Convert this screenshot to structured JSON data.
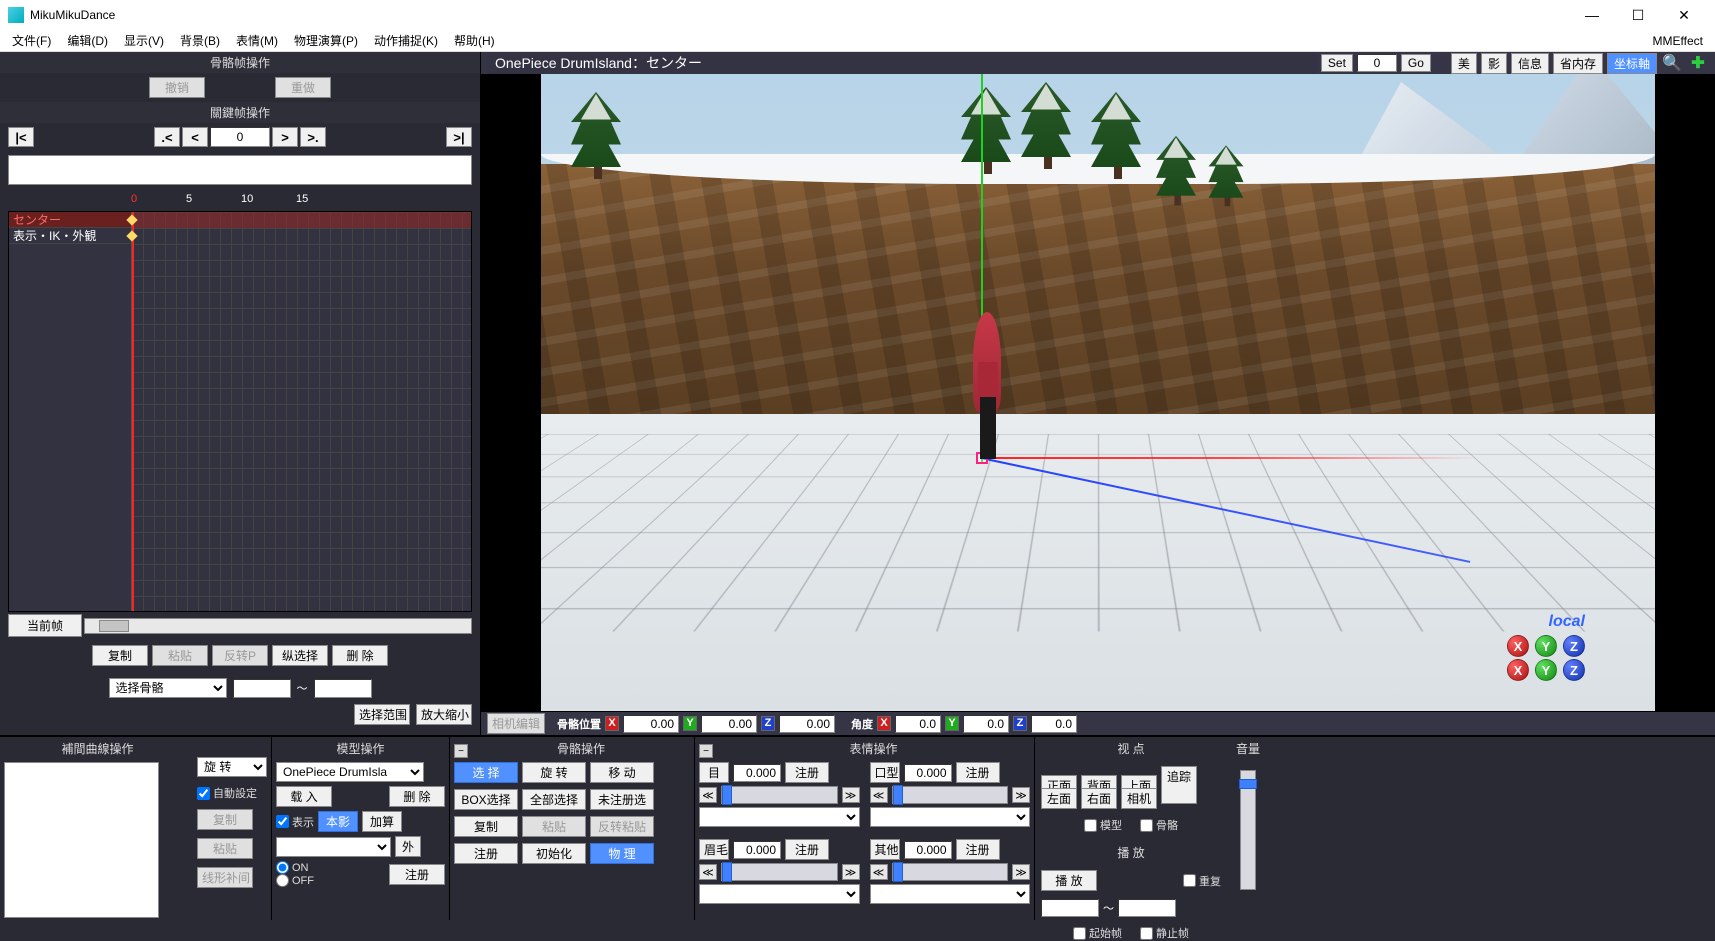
{
  "title": "MikuMikuDance",
  "menubar": [
    "文件(F)",
    "编辑(D)",
    "显示(V)",
    "背景(B)",
    "表情(M)",
    "物理演算(P)",
    "动作捕捉(K)",
    "帮助(H)"
  ],
  "mmeffect": "MMEffect",
  "bone_ops_title": "骨骼帧操作",
  "undo": "撤销",
  "redo": "重做",
  "key_ops_title": "關鍵帧操作",
  "frame_current": "0",
  "ruler": [
    "0",
    "5",
    "10",
    "15"
  ],
  "tracks": [
    "センター",
    "表示・IK・外観"
  ],
  "current_frame_label": "当前帧",
  "frame_ops": {
    "copy": "复制",
    "paste": "粘贴",
    "reverse": "反转P",
    "colsel": "纵选择",
    "delete": "删 除"
  },
  "select_bone": "选择骨骼",
  "range_sep": "～",
  "select_range": "选择范围",
  "zoom": "放大缩小",
  "view": {
    "title": "OnePiece DrumIsland：センター",
    "set": "Set",
    "set_val": "0",
    "go": "Go",
    "beauty": "美",
    "shadow": "影",
    "info": "信息",
    "savemem": "省内存",
    "axes": "坐标軸",
    "local": "local"
  },
  "status": {
    "cam_edit": "相机编辑",
    "bone_pos": "骨骼位置",
    "x": "0.00",
    "y": "0.00",
    "z": "0.00",
    "angle": "角度",
    "ax": "0.0",
    "ay": "0.0",
    "az": "0.0"
  },
  "curve": {
    "title": "補間曲線操作",
    "rotate": "旋 转",
    "auto": "自動設定",
    "copy": "复制",
    "paste": "粘贴",
    "linear": "线形补间"
  },
  "model": {
    "title": "模型操作",
    "dropdown": "OnePiece DrumIsla",
    "load": "载 入",
    "delete": "删 除",
    "show": "表示",
    "shadow": "本影",
    "add": "加算",
    "outer": "外",
    "on": "ON",
    "off": "OFF",
    "register": "注册"
  },
  "bone": {
    "title": "骨骼操作",
    "select": "选 择",
    "rotate": "旋 转",
    "move": "移 动",
    "box": "BOX选择",
    "all": "全部选择",
    "unreg": "未注册选",
    "copy": "复制",
    "paste": "粘贴",
    "revpaste": "反转粘贴",
    "register": "注册",
    "init": "初始化",
    "physics": "物 理"
  },
  "expr": {
    "title": "表情操作",
    "eye": "目",
    "mouth": "口型",
    "brow": "眉毛",
    "other": "其他",
    "val": "0.000",
    "register": "注册"
  },
  "viewp": {
    "title": "视 点",
    "front": "正面",
    "back": "背面",
    "top": "上面",
    "left": "左面",
    "right": "右面",
    "camera": "相机",
    "track": "追踪",
    "model": "模型",
    "bone": "骨骼"
  },
  "play": {
    "title": "播 放",
    "play": "播 放",
    "repeat": "重复",
    "from": "起始帧",
    "to": "静止帧",
    "sep": "～"
  },
  "volume": "音量"
}
